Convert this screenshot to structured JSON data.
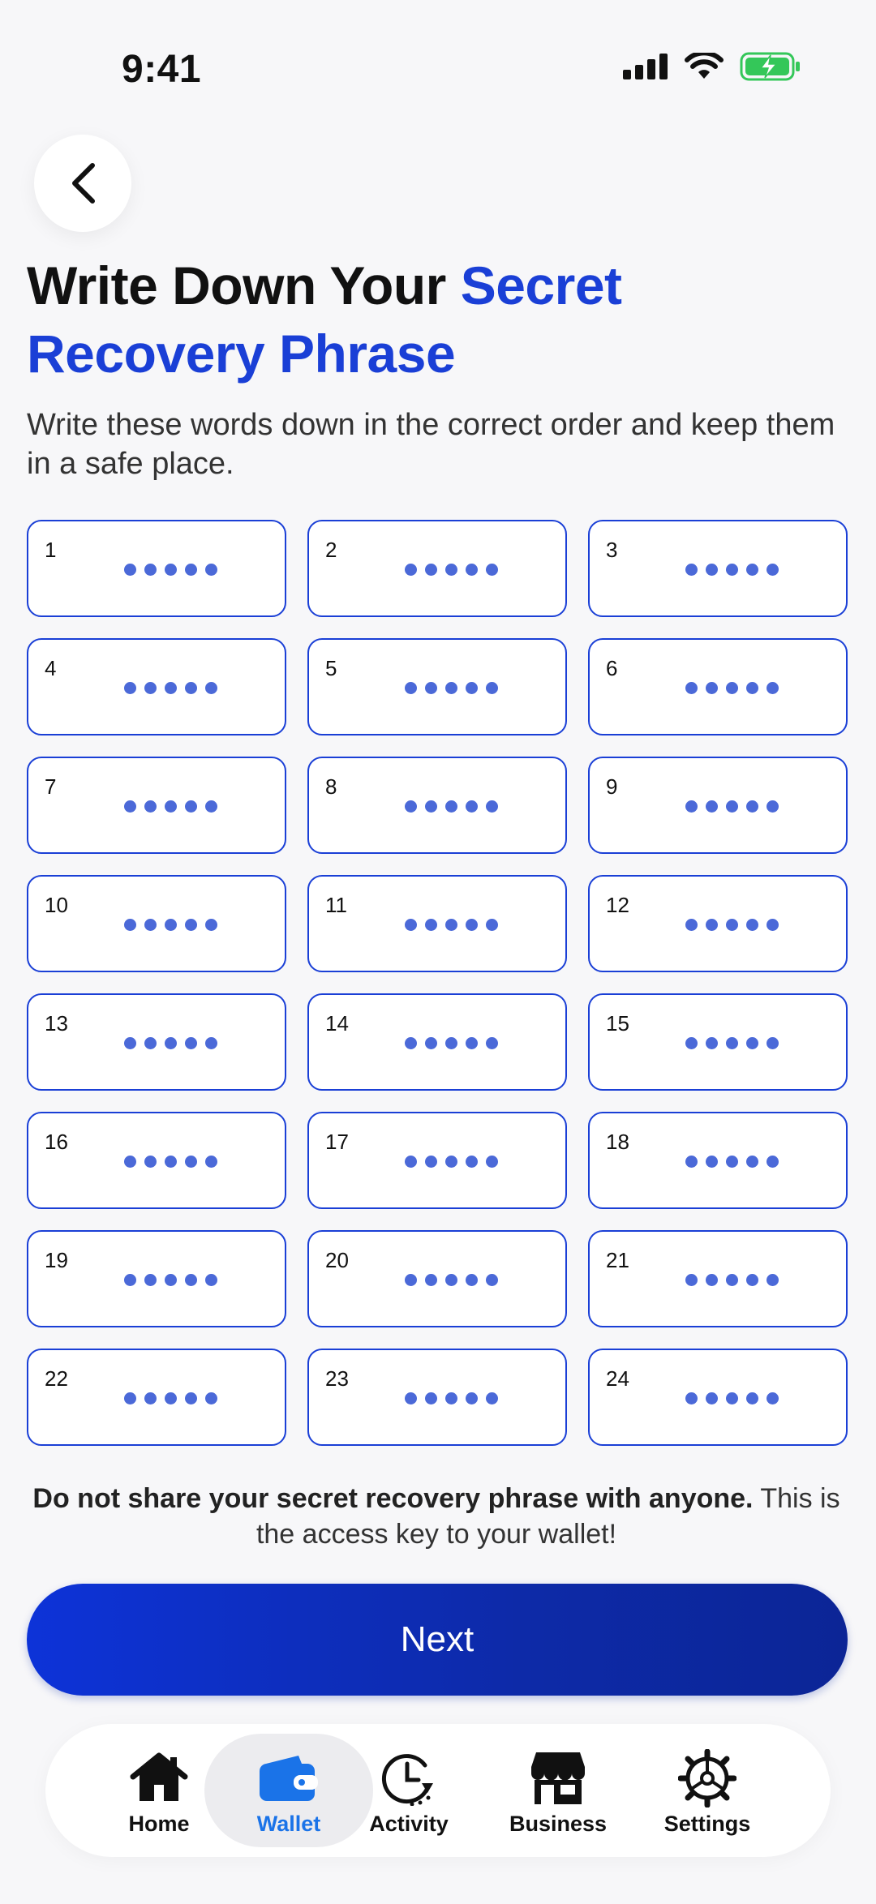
{
  "status_bar": {
    "time": "9:41"
  },
  "header": {
    "title_part1": "Write Down Your ",
    "title_accent": "Secret Recovery Phrase",
    "subtitle": "Write these words down in the correct order and keep them in a safe place."
  },
  "words": [
    {
      "n": "1"
    },
    {
      "n": "2"
    },
    {
      "n": "3"
    },
    {
      "n": "4"
    },
    {
      "n": "5"
    },
    {
      "n": "6"
    },
    {
      "n": "7"
    },
    {
      "n": "8"
    },
    {
      "n": "9"
    },
    {
      "n": "10"
    },
    {
      "n": "11"
    },
    {
      "n": "12"
    },
    {
      "n": "13"
    },
    {
      "n": "14"
    },
    {
      "n": "15"
    },
    {
      "n": "16"
    },
    {
      "n": "17"
    },
    {
      "n": "18"
    },
    {
      "n": "19"
    },
    {
      "n": "20"
    },
    {
      "n": "21"
    },
    {
      "n": "22"
    },
    {
      "n": "23"
    },
    {
      "n": "24"
    }
  ],
  "warning": {
    "bold": "Do not share your secret recovery phrase with anyone.",
    "rest": " This is the access key to your wallet!"
  },
  "next_label": "Next",
  "tabs": [
    {
      "label": "Home",
      "icon": "home-icon"
    },
    {
      "label": "Wallet",
      "icon": "wallet-icon",
      "active": true
    },
    {
      "label": "Activity",
      "icon": "activity-icon"
    },
    {
      "label": "Business",
      "icon": "business-icon"
    },
    {
      "label": "Settings",
      "icon": "settings-icon"
    }
  ],
  "colors": {
    "accent": "#1a3fd6",
    "dots": "#4b69d8",
    "tab_active": "#1a73e8",
    "battery": "#34c759"
  }
}
